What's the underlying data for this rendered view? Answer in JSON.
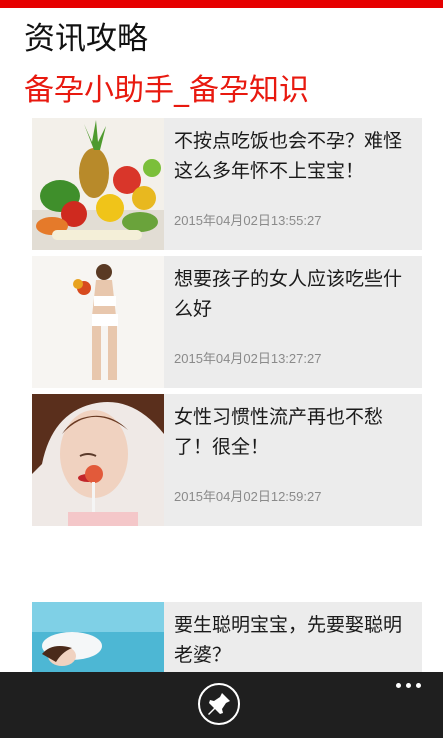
{
  "app": {
    "title": "资讯攻略"
  },
  "section": {
    "title": "备孕小助手_备孕知识"
  },
  "articles": [
    {
      "title": "不按点吃饭也会不孕？难怪这么多年怀不上宝宝！",
      "date": "2015年04月02日13:55:27",
      "image": "vegetables-photo"
    },
    {
      "title": "想要孩子的女人应该吃些什么好",
      "date": "2015年04月02日13:27:27",
      "image": "woman-holding-fruit-photo"
    },
    {
      "title": "女性习惯性流产再也不愁了！很全！",
      "date": "2015年04月02日12:59:27",
      "image": "woman-with-lollipop-photo"
    },
    {
      "title": "要生聪明宝宝，先要娶聪明老婆？",
      "date": "",
      "image": "woman-resting-photo"
    }
  ],
  "appbar": {
    "pin_icon": "pin-icon",
    "more_icon": "more-icon"
  },
  "colors": {
    "accent": "#e60000",
    "section_title": "#e8190f",
    "card_bg": "#ececec",
    "appbar_bg": "#1f1f1f"
  }
}
